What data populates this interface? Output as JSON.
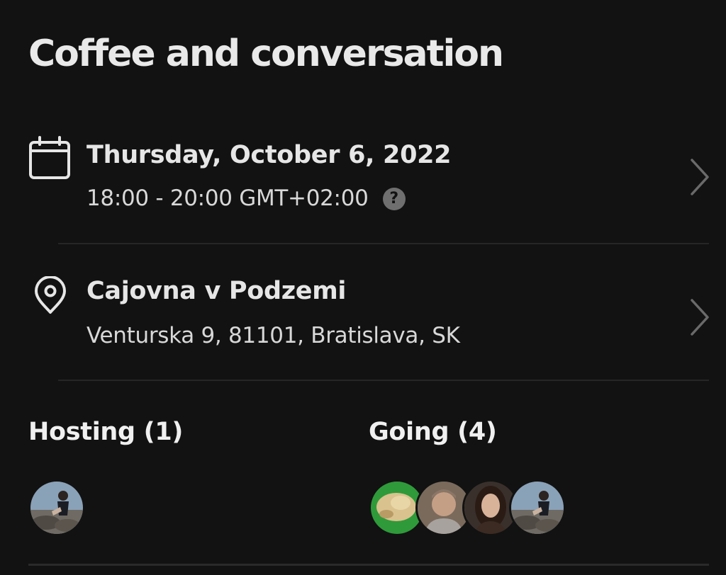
{
  "event": {
    "title": "Coffee and conversation"
  },
  "date_row": {
    "icon": "calendar-icon",
    "date": "Thursday, October 6, 2022",
    "time": "18:00 - 20:00 GMT+02:00",
    "help_icon_glyph": "?"
  },
  "venue_row": {
    "icon": "location-pin-icon",
    "name": "Cajovna v Podzemi",
    "address": "Venturska 9, 81101, Bratislava, SK"
  },
  "hosting": {
    "label": "Hosting (1)",
    "avatars": [
      "avatar-photo"
    ]
  },
  "going": {
    "label": "Going (4)",
    "avatars": [
      "avatar-photo",
      "avatar-photo",
      "avatar-photo",
      "avatar-photo"
    ]
  },
  "colors": {
    "background": "#121212",
    "text_primary": "#e6e6e6",
    "divider": "#262626"
  }
}
